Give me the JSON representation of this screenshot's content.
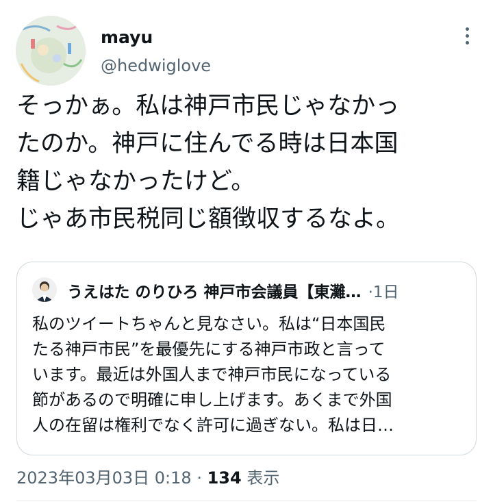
{
  "tweet": {
    "author_name": "mayu",
    "author_handle": "@hedwiglove",
    "text_lines": [
      "そっかぁ。私は神戸市民じゃなかっ",
      "たのか。神戸に住んでる時は日本国",
      "籍じゃなかったけど。",
      "じゃあ市民税同じ額徴収するなよ。"
    ],
    "timestamp": "2023年03月03日 0:18",
    "separator": "·",
    "views_count": "134",
    "views_label": "表示"
  },
  "quoted_tweet": {
    "author_name": "うえはた のりひろ 神戸市会議員【東灘…",
    "separator": "·",
    "time": "1日",
    "text_lines": [
      "私のツイートちゃんと見なさい。私は“日本国民",
      "たる神戸市民”を最優先にする神戸市政と言って",
      "います。最近は外国人まで神戸市民になっている",
      "節があるので明確に申し上げます。あくまで外国",
      "人の在留は権利でなく許可に過ぎない。私は日…"
    ]
  },
  "icons": {
    "more": "more-options-icon",
    "avatar": "profile-avatar",
    "quoted_avatar": "quoted-profile-avatar"
  },
  "colors": {
    "text_primary": "#0f1419",
    "text_secondary": "#536471",
    "border": "#cfd9de"
  }
}
